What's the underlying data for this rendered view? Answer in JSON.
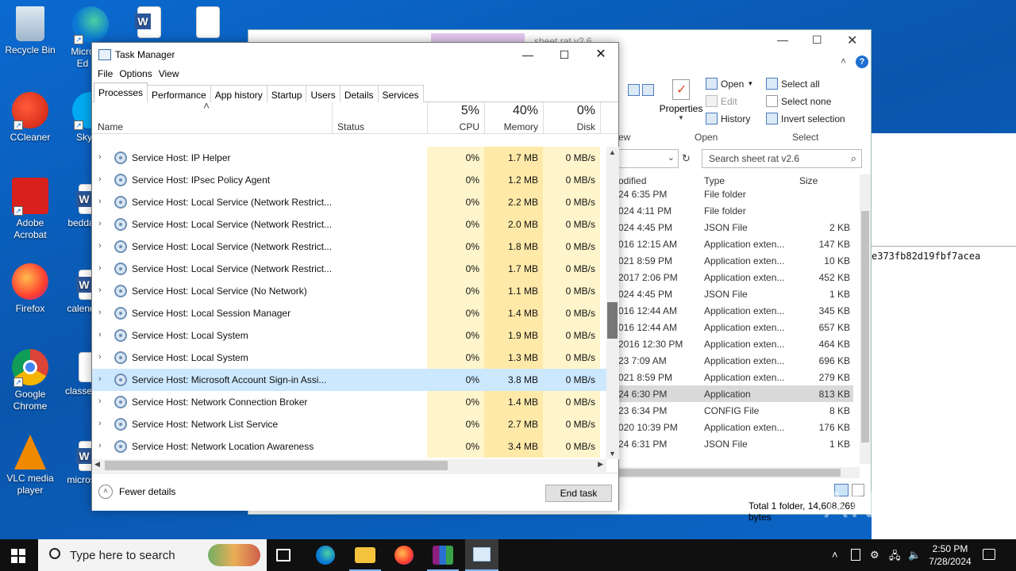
{
  "desktop": {
    "icons": [
      {
        "label": "Recycle Bin",
        "icon": "recycle-bin-icon"
      },
      {
        "label": "CCleaner",
        "icon": "ccleaner-icon"
      },
      {
        "label": "Adobe Acrobat",
        "icon": "adobe-acrobat-icon"
      },
      {
        "label": "Firefox",
        "icon": "firefox-icon"
      },
      {
        "label": "Google Chrome",
        "icon": "chrome-icon"
      },
      {
        "label": "VLC media player",
        "icon": "vlc-icon"
      },
      {
        "label": "Micro Ed",
        "icon": "edge-icon"
      },
      {
        "label": "Sky",
        "icon": "skype-icon"
      },
      {
        "label": "bedda",
        "icon": "word-doc-icon"
      },
      {
        "label": "calend",
        "icon": "word-doc-icon"
      },
      {
        "label": "classes",
        "icon": "image-file-icon"
      },
      {
        "label": "micros",
        "icon": "word-doc-icon"
      }
    ]
  },
  "explorer": {
    "title_fragment": "sheet rat v2.6",
    "ribbon": {
      "properties": "Properties",
      "open": "Open",
      "edit": "Edit",
      "history": "History",
      "select_all": "Select all",
      "select_none": "Select none",
      "invert_selection": "Invert selection",
      "group_open": "Open",
      "group_select": "Select",
      "group_new_fragment": "ew"
    },
    "search_placeholder": "Search sheet rat v2.6",
    "columns": {
      "modified": "odified",
      "type": "Type",
      "size": "Size"
    },
    "rows": [
      {
        "date": "24 6:35 PM",
        "type": "File folder",
        "size": ""
      },
      {
        "date": "024 4:11 PM",
        "type": "File folder",
        "size": ""
      },
      {
        "date": "024 4:45 PM",
        "type": "JSON File",
        "size": "2 KB"
      },
      {
        "date": "016 12:15 AM",
        "type": "Application exten...",
        "size": "147 KB"
      },
      {
        "date": "021 8:59 PM",
        "type": "Application exten...",
        "size": "10 KB"
      },
      {
        "date": "2017 2:06 PM",
        "type": "Application exten...",
        "size": "452 KB"
      },
      {
        "date": "024 4:45 PM",
        "type": "JSON File",
        "size": "1 KB"
      },
      {
        "date": "016 12:44 AM",
        "type": "Application exten...",
        "size": "345 KB"
      },
      {
        "date": "016 12:44 AM",
        "type": "Application exten...",
        "size": "657 KB"
      },
      {
        "date": "2016 12:30 PM",
        "type": "Application exten...",
        "size": "464 KB"
      },
      {
        "date": "23 7:09 AM",
        "type": "Application exten...",
        "size": "696 KB"
      },
      {
        "date": "021 8:59 PM",
        "type": "Application exten...",
        "size": "279 KB"
      },
      {
        "date": "24 6:30 PM",
        "type": "Application",
        "size": "813 KB"
      },
      {
        "date": "23 6:34 PM",
        "type": "CONFIG File",
        "size": "8 KB"
      },
      {
        "date": "020 10:39 PM",
        "type": "Application exten...",
        "size": "176 KB"
      },
      {
        "date": "24 6:31 PM",
        "type": "JSON File",
        "size": "1 KB"
      }
    ],
    "selected_row": 12,
    "status": "Total 1 folder, 14,608,269 bytes"
  },
  "cmd": {
    "text": "e373fb82d19fbf7acea"
  },
  "task_manager": {
    "title": "Task Manager",
    "menu": [
      "File",
      "Options",
      "View"
    ],
    "tabs": [
      "Processes",
      "Performance",
      "App history",
      "Startup",
      "Users",
      "Details",
      "Services"
    ],
    "active_tab": 0,
    "columns": {
      "name": "Name",
      "status": "Status",
      "cpu_pct": "5%",
      "cpu": "CPU",
      "mem_pct": "40%",
      "mem": "Memory",
      "disk_pct": "0%",
      "disk": "Disk"
    },
    "rows": [
      {
        "name": "Service Host: IP Helper",
        "cpu": "0%",
        "mem": "1.7 MB",
        "disk": "0 MB/s"
      },
      {
        "name": "Service Host: IPsec Policy Agent",
        "cpu": "0%",
        "mem": "1.2 MB",
        "disk": "0 MB/s"
      },
      {
        "name": "Service Host: Local Service (Network Restrict...",
        "cpu": "0%",
        "mem": "2.2 MB",
        "disk": "0 MB/s"
      },
      {
        "name": "Service Host: Local Service (Network Restrict...",
        "cpu": "0%",
        "mem": "2.0 MB",
        "disk": "0 MB/s"
      },
      {
        "name": "Service Host: Local Service (Network Restrict...",
        "cpu": "0%",
        "mem": "1.8 MB",
        "disk": "0 MB/s"
      },
      {
        "name": "Service Host: Local Service (Network Restrict...",
        "cpu": "0%",
        "mem": "1.7 MB",
        "disk": "0 MB/s"
      },
      {
        "name": "Service Host: Local Service (No Network)",
        "cpu": "0%",
        "mem": "1.1 MB",
        "disk": "0 MB/s"
      },
      {
        "name": "Service Host: Local Session Manager",
        "cpu": "0%",
        "mem": "1.4 MB",
        "disk": "0 MB/s"
      },
      {
        "name": "Service Host: Local System",
        "cpu": "0%",
        "mem": "1.9 MB",
        "disk": "0 MB/s"
      },
      {
        "name": "Service Host: Local System",
        "cpu": "0%",
        "mem": "1.3 MB",
        "disk": "0 MB/s"
      },
      {
        "name": "Service Host: Microsoft Account Sign-in Assi...",
        "cpu": "0%",
        "mem": "3.8 MB",
        "disk": "0 MB/s"
      },
      {
        "name": "Service Host: Network Connection Broker",
        "cpu": "0%",
        "mem": "1.4 MB",
        "disk": "0 MB/s"
      },
      {
        "name": "Service Host: Network List Service",
        "cpu": "0%",
        "mem": "2.7 MB",
        "disk": "0 MB/s"
      },
      {
        "name": "Service Host: Network Location Awareness",
        "cpu": "0%",
        "mem": "3.4 MB",
        "disk": "0 MB/s"
      }
    ],
    "selected_row": 10,
    "fewer_details": "Fewer details",
    "end_task": "End task"
  },
  "taskbar": {
    "search_placeholder": "Type here to search",
    "time": "2:50 PM",
    "date": "7/28/2024"
  },
  "watermark": "ANY RUN"
}
